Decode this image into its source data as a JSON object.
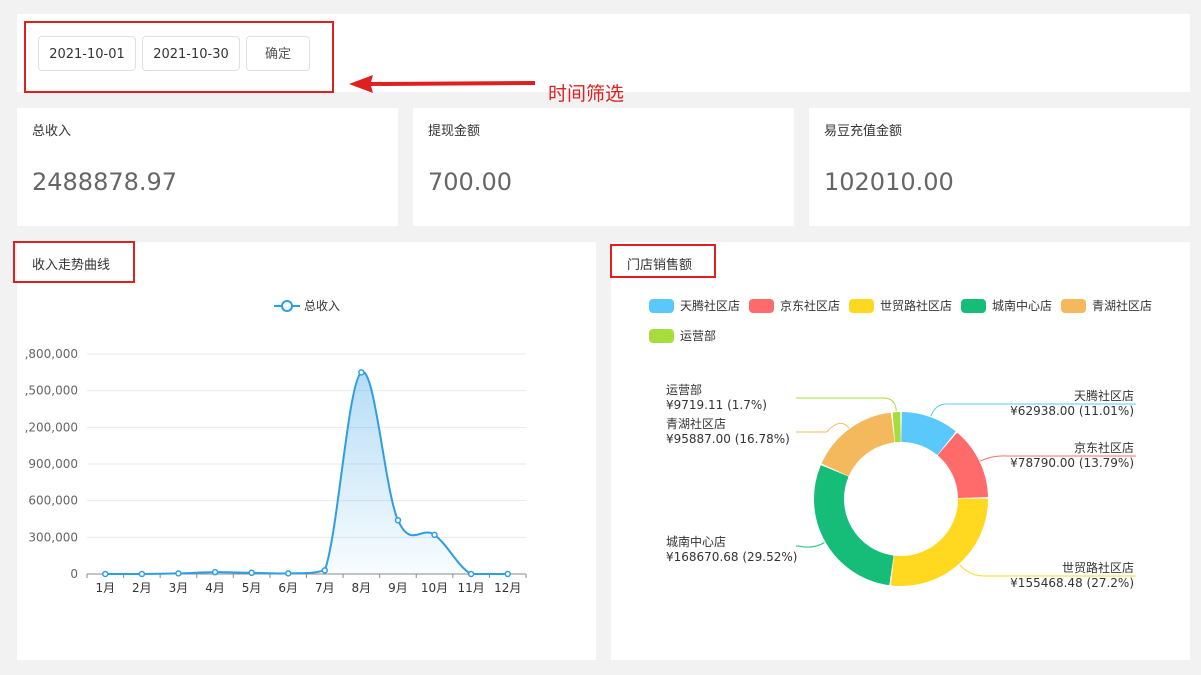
{
  "filter": {
    "start_date": "2021-10-01",
    "end_date": "2021-10-30",
    "confirm_label": "确定",
    "annotation": "时间筛选"
  },
  "stats": [
    {
      "label": "总收入",
      "value": "2488878.97"
    },
    {
      "label": "提现金额",
      "value": "700.00"
    },
    {
      "label": "易豆充值金额",
      "value": "102010.00"
    }
  ],
  "line_panel": {
    "title": "收入走势曲线"
  },
  "pie_panel": {
    "title": "门店销售额"
  },
  "colors": {
    "annotation_red": "#e02020",
    "line_blue": "#2d9ee6"
  },
  "chart_data": [
    {
      "type": "line",
      "categories": [
        "1月",
        "2月",
        "3月",
        "4月",
        "5月",
        "6月",
        "7月",
        "8月",
        "9月",
        "10月",
        "11月",
        "12月"
      ],
      "series": [
        {
          "name": "总收入",
          "values": [
            0,
            0,
            5000,
            15000,
            10000,
            5000,
            30000,
            1650000,
            440000,
            320000,
            0,
            0
          ],
          "color": "#2d9ee6"
        }
      ],
      "y_tick_labels": [
        "0",
        "300,000",
        "600,000",
        "900,000",
        ",200,000",
        ",500,000",
        ",800,000"
      ],
      "ylim": [
        0,
        1800000
      ],
      "smooth": true,
      "area_fill": true,
      "legend_position": "top-center",
      "grid": "horizontal"
    },
    {
      "type": "pie",
      "donut": true,
      "legend_position": "top-left",
      "slices": [
        {
          "name": "天腾社区店",
          "value": 62938.0,
          "label": "¥62938.00 (11.01%)",
          "color": "#5ac8fa"
        },
        {
          "name": "京东社区店",
          "value": 78790.0,
          "label": "¥78790.00 (13.79%)",
          "color": "#ff6b6b"
        },
        {
          "name": "世贸路社区店",
          "value": 155468.48,
          "label": "¥155468.48 (27.2%)",
          "color": "#ffd81f"
        },
        {
          "name": "城南中心店",
          "value": 168670.68,
          "label": "¥168670.68 (29.52%)",
          "color": "#15bd79"
        },
        {
          "name": "青湖社区店",
          "value": 95887.0,
          "label": "¥95887.00 (16.78%)",
          "color": "#f4b95c"
        },
        {
          "name": "运营部",
          "value": 9719.11,
          "label": "¥9719.11 (1.7%)",
          "color": "#a6dc3c"
        }
      ]
    }
  ]
}
